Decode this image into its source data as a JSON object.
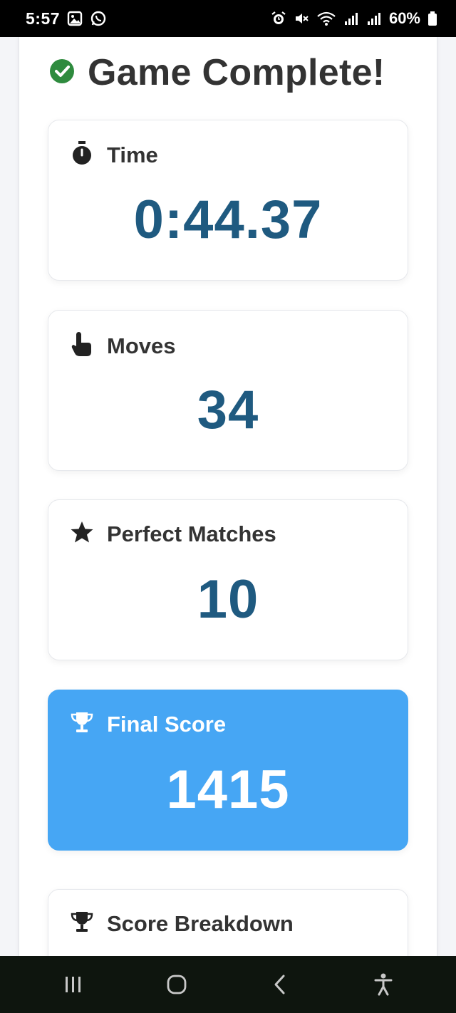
{
  "status_bar": {
    "time": "5:57",
    "battery": "60%"
  },
  "header": {
    "title": "Game Complete!"
  },
  "cards": {
    "time": {
      "label": "Time",
      "value": "0:44.37"
    },
    "moves": {
      "label": "Moves",
      "value": "34"
    },
    "perfect": {
      "label": "Perfect Matches",
      "value": "10"
    },
    "final": {
      "label": "Final Score",
      "value": "1415"
    },
    "breakdown": {
      "label": "Score Breakdown"
    }
  },
  "colors": {
    "value_text": "#1f5a80",
    "accent_card": "#46a6f4",
    "check": "#2e8b3e"
  },
  "icons": {
    "title": "check-circle-icon",
    "time": "stopwatch-icon",
    "moves": "pointer-hand-icon",
    "perfect": "star-icon",
    "final": "trophy-icon",
    "breakdown": "trophy-icon"
  }
}
